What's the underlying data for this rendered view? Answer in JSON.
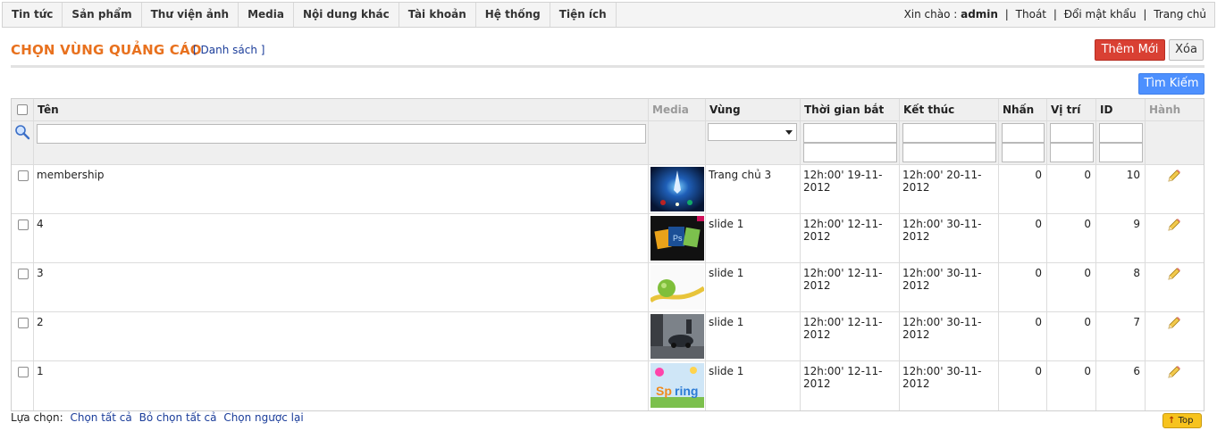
{
  "nav": {
    "items": [
      "Tin tức",
      "Sản phẩm",
      "Thư viện ảnh",
      "Media",
      "Nội dung khác",
      "Tài khoản",
      "Hệ thống",
      "Tiện ích"
    ],
    "greeting": "Xin chào : ",
    "username": "admin",
    "logout": "Thoát",
    "change_password": "Đổi mật khẩu",
    "home": "Trang chủ",
    "separator": "|"
  },
  "header": {
    "title": "CHỌN VÙNG QUẢNG CÁO",
    "list_link": "[ Danh sách ]",
    "add_button": "Thêm Mới",
    "delete_button": "Xóa",
    "search_button": "Tìm Kiếm"
  },
  "table": {
    "columns": [
      "Tên",
      "Media",
      "Vùng",
      "Thời gian bắt đầu",
      "Kết thúc",
      "Nhấn",
      "Vị trí",
      "ID",
      "Hành động"
    ],
    "rows": [
      {
        "name": "membership",
        "media": "space-image",
        "zone": "Trang chủ 3",
        "start": "12h:00' 19-11-2012",
        "end": "12h:00' 20-11-2012",
        "clicks": "0",
        "position": "0",
        "id": "10"
      },
      {
        "name": "4",
        "media": "adobe-icons-image",
        "zone": "slide 1",
        "start": "12h:00' 12-11-2012",
        "end": "12h:00' 30-11-2012",
        "clicks": "0",
        "position": "0",
        "id": "9"
      },
      {
        "name": "3",
        "media": "apple-tape-image",
        "zone": "slide 1",
        "start": "12h:00' 12-11-2012",
        "end": "12h:00' 30-11-2012",
        "clicks": "0",
        "position": "0",
        "id": "8"
      },
      {
        "name": "2",
        "media": "car-street-image",
        "zone": "slide 1",
        "start": "12h:00' 12-11-2012",
        "end": "12h:00' 30-11-2012",
        "clicks": "0",
        "position": "0",
        "id": "7"
      },
      {
        "name": "1",
        "media": "spring-text-image",
        "zone": "slide 1",
        "start": "12h:00' 12-11-2012",
        "end": "12h:00' 30-11-2012",
        "clicks": "0",
        "position": "0",
        "id": "6"
      }
    ]
  },
  "footer": {
    "label": "Lựa chọn:",
    "select_all": "Chọn tất cả",
    "deselect_all": "Bỏ chọn tất cả",
    "invert": "Chọn ngược lại",
    "top_button": "Top"
  },
  "colors": {
    "title": "#e8711e",
    "add_button": "#d94033",
    "search_button": "#4d90fe",
    "link": "#1b3d9a"
  }
}
